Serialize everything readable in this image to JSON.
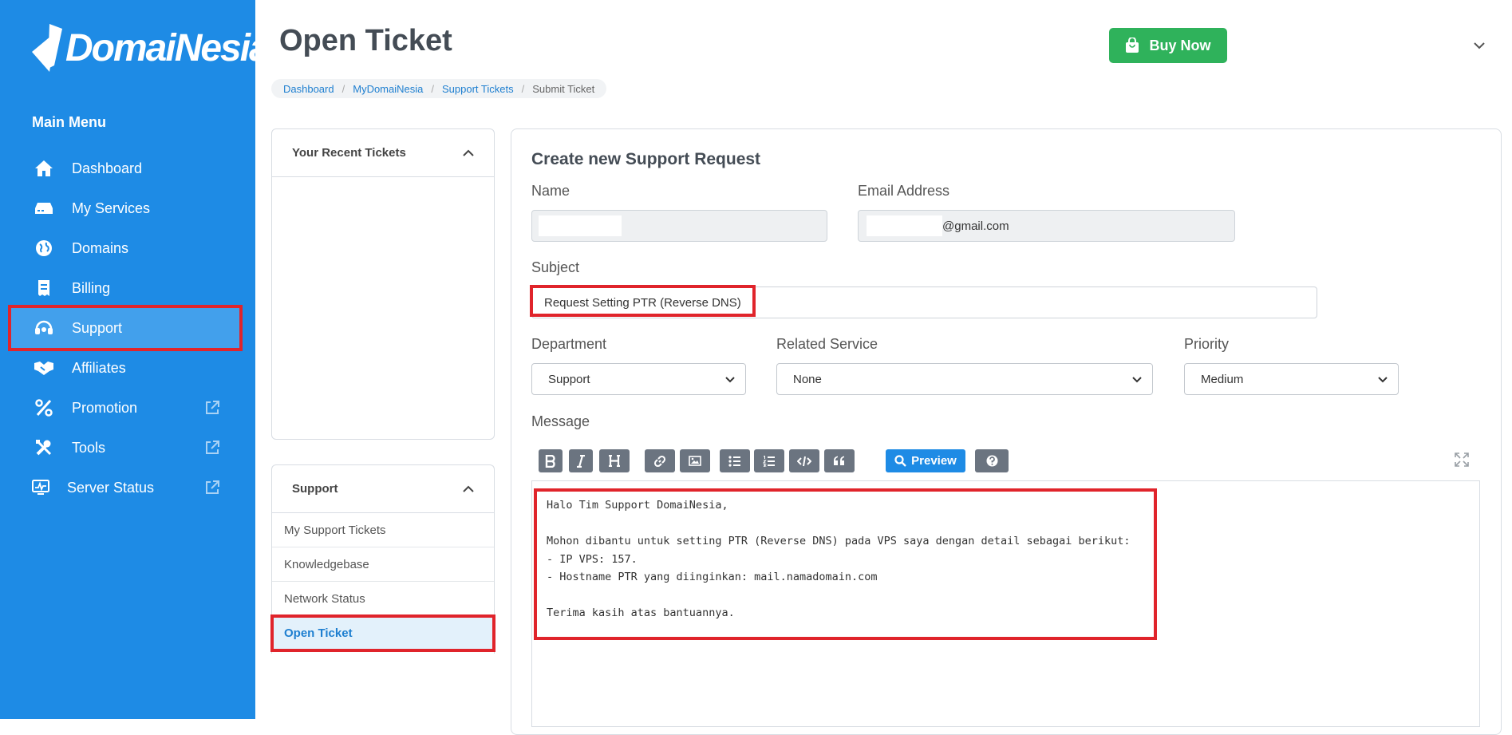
{
  "brand": {
    "name": "DomaiNesia"
  },
  "sidebar": {
    "title": "Main Menu",
    "items": [
      {
        "label": "Dashboard",
        "icon": "home-icon"
      },
      {
        "label": "My Services",
        "icon": "server-icon"
      },
      {
        "label": "Domains",
        "icon": "globe-icon"
      },
      {
        "label": "Billing",
        "icon": "receipt-icon"
      },
      {
        "label": "Support",
        "icon": "headset-icon",
        "active": true
      },
      {
        "label": "Affiliates",
        "icon": "handshake-icon"
      },
      {
        "label": "Promotion",
        "icon": "percent-icon",
        "external": true
      },
      {
        "label": "Tools",
        "icon": "tools-icon",
        "external": true
      },
      {
        "label": "Server Status",
        "icon": "monitor-icon",
        "external": true
      }
    ]
  },
  "header": {
    "title": "Open Ticket",
    "buy_now": "Buy Now",
    "breadcrumb": [
      "Dashboard",
      "MyDomaiNesia",
      "Support Tickets",
      "Submit Ticket"
    ]
  },
  "recent_tickets": {
    "title": "Your Recent Tickets"
  },
  "support_panel": {
    "title": "Support",
    "links": [
      "My Support Tickets",
      "Knowledgebase",
      "Network Status",
      "Open Ticket"
    ]
  },
  "form": {
    "title": "Create new Support Request",
    "name_label": "Name",
    "email_label": "Email Address",
    "email_suffix": "@gmail.com",
    "subject_label": "Subject",
    "subject_value": "Request Setting PTR (Reverse DNS)",
    "department_label": "Department",
    "department_value": "Support",
    "related_label": "Related Service",
    "related_value": "None",
    "priority_label": "Priority",
    "priority_value": "Medium",
    "message_label": "Message",
    "preview_label": "Preview",
    "message_lines": [
      "Halo Tim Support DomaiNesia,",
      "",
      "Mohon dibantu untuk setting PTR (Reverse DNS) pada VPS saya dengan detail sebagai berikut:",
      "- IP VPS: 157.",
      "- Hostname PTR yang diinginkan: mail.namadomain.com",
      "",
      "Terima kasih atas bantuannya."
    ]
  },
  "colors": {
    "sidebar": "#1e8be5",
    "accent_green": "#2fb25b",
    "highlight_red": "#e0242b",
    "link_blue": "#1e7fd0"
  }
}
